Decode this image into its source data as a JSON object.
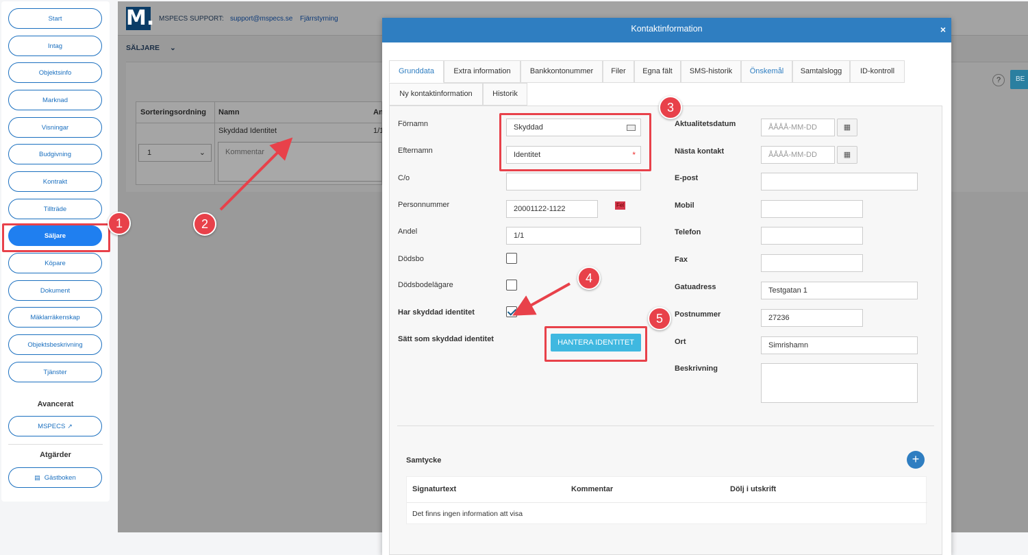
{
  "sidebar": {
    "items": [
      "Start",
      "Intag",
      "Objektsinfo",
      "Marknad",
      "Visningar",
      "Budgivning",
      "Kontrakt",
      "Tillträde",
      "Säljare",
      "Köpare",
      "Dokument",
      "Mäklarräkenskap",
      "Objektsbeskrivning",
      "Tjänster"
    ],
    "active": "Säljare",
    "advanced_heading": "Avancerat",
    "mspecs_label": "MSPECS",
    "actions_heading": "Atgärder",
    "guestbook_label": "Gästboken"
  },
  "app": {
    "logo": "M.",
    "support_label": "MSPECS SUPPORT:",
    "support_email": "support@mspecs.se",
    "remote_label": "Fjärrstyrning",
    "section_label": "SÄLJARE",
    "help": "?",
    "btn_partial": "BE",
    "table": {
      "headers": [
        "Sorteringsordning",
        "Namn",
        "An"
      ],
      "name_value": "Skyddad Identitet",
      "share_partial": "1/1",
      "sort_value": "1",
      "comment_placeholder": "Kommentar"
    }
  },
  "modal": {
    "title": "Kontaktinformation",
    "close": "×",
    "tabs_row1": [
      "Grunddata",
      "Extra information",
      "Bankkontonummer",
      "Filer",
      "Egna fält",
      "SMS-historik",
      "Önskemål",
      "Samtalslogg",
      "ID-kontroll"
    ],
    "tabs_row2": [
      "Ny kontaktinformation",
      "Historik"
    ],
    "left": {
      "fornamn_label": "Förnamn",
      "fornamn_value": "Skyddad",
      "efternamn_label": "Efternamn",
      "efternamn_value": "Identitet",
      "co_label": "C/o",
      "personnummer_label": "Personnummer",
      "personnummer_value": "20001122-1122",
      "fel": "Fel",
      "andel_label": "Andel",
      "andel_value": "1/1",
      "dodsbo_label": "Dödsbo",
      "dodsbodelagare_label": "Dödsbodelägare",
      "skyddad_label": "Har skyddad identitet",
      "satt_label": "Sätt som skyddad identitet",
      "hantera_button": "HANTERA IDENTITET",
      "required_mark": "*"
    },
    "right": {
      "aktualitet_label": "Aktualitetsdatum",
      "date_placeholder": "ÅÅÅÅ-MM-DD",
      "nasta_label": "Nästa kontakt",
      "epost_label": "E-post",
      "mobil_label": "Mobil",
      "telefon_label": "Telefon",
      "fax_label": "Fax",
      "gatuadress_label": "Gatuadress",
      "gatuadress_value": "Testgatan 1",
      "postnummer_label": "Postnummer",
      "postnummer_value": "27236",
      "ort_label": "Ort",
      "ort_value": "Simrishamn",
      "beskrivning_label": "Beskrivning"
    },
    "samtycke": {
      "title": "Samtycke",
      "headers": [
        "Signaturtext",
        "Kommentar",
        "Dölj i utskrift"
      ],
      "empty": "Det finns ingen information att visa",
      "add": "+"
    }
  },
  "annotations": [
    "1",
    "2",
    "3",
    "4",
    "5"
  ],
  "colors": {
    "accent": "#2f7ec1",
    "annotation": "#e8414a",
    "active_nav": "#1f7ff0",
    "hantera": "#3fb8e0"
  }
}
